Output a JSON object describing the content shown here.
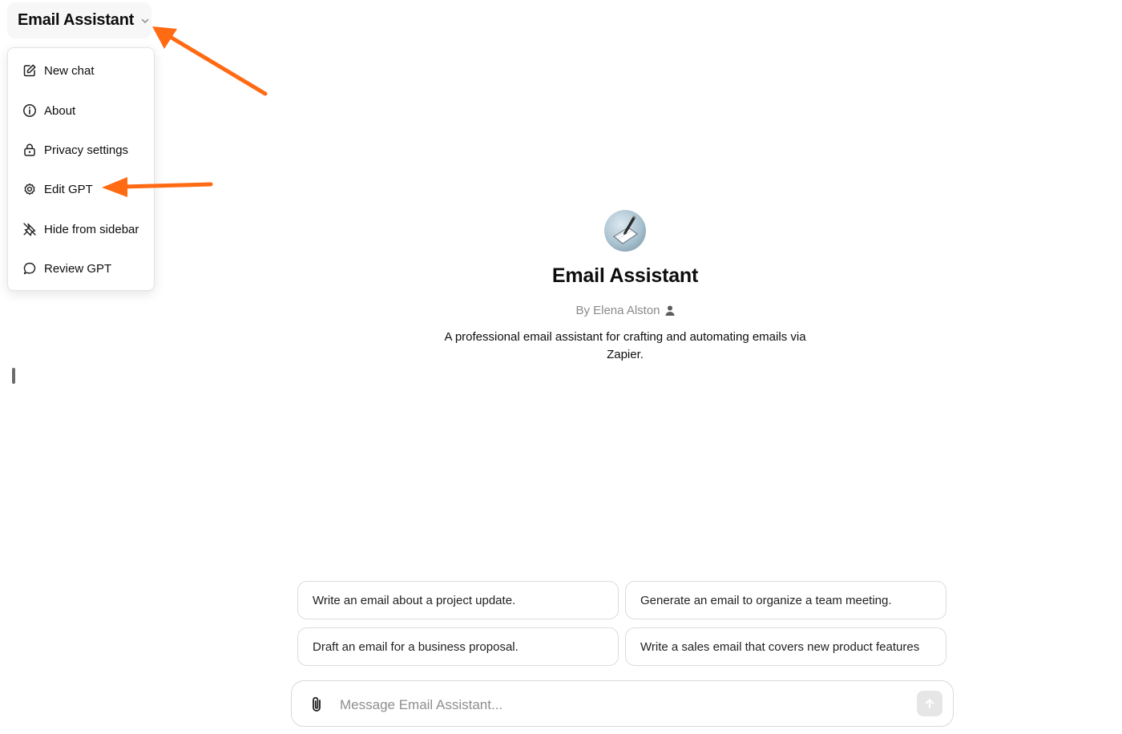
{
  "header": {
    "gpt_name": "Email Assistant"
  },
  "menu": {
    "items": [
      {
        "label": "New chat",
        "icon": "pencil-square-icon"
      },
      {
        "label": "About",
        "icon": "info-icon"
      },
      {
        "label": "Privacy settings",
        "icon": "lock-icon"
      },
      {
        "label": "Edit GPT",
        "icon": "gear-icon"
      },
      {
        "label": "Hide from sidebar",
        "icon": "unpin-icon"
      },
      {
        "label": "Review GPT",
        "icon": "speech-bubble-icon"
      }
    ]
  },
  "hero": {
    "title": "Email Assistant",
    "byline": "By Elena Alston",
    "description": "A professional email assistant for crafting and automating emails via Zapier."
  },
  "suggestions": [
    "Write an email about a project update.",
    "Generate an email to organize a team meeting.",
    "Draft an email for a business proposal.",
    "Write a sales email that covers new product features"
  ],
  "composer": {
    "placeholder": "Message Email Assistant..."
  },
  "colors": {
    "annotation_arrow": "#ff6a13",
    "send_button_bg": "#e6e6e6"
  }
}
